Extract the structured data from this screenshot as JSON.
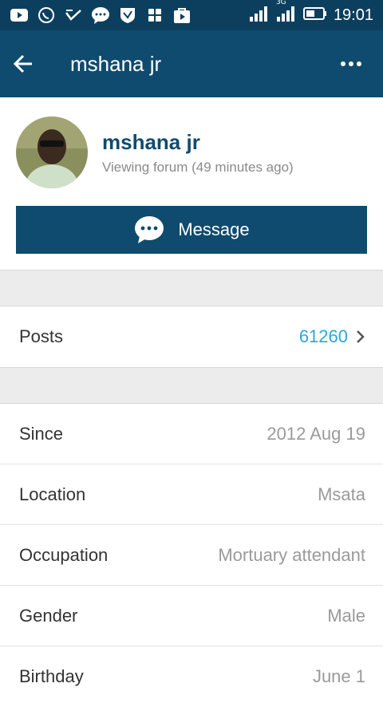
{
  "status_bar": {
    "time": "19:01",
    "network": "3G",
    "icons": [
      "youtube-icon",
      "whatsapp-icon",
      "check-icon",
      "chat-icon",
      "vpn-icon",
      "apps-icon",
      "play-store-icon"
    ]
  },
  "app_bar": {
    "title": "mshana jr",
    "back_icon": "arrow-back-icon",
    "more_icon": "more-horizontal-icon"
  },
  "profile": {
    "username": "mshana jr",
    "activity": "Viewing forum (49 minutes ago)",
    "message_button": "Message"
  },
  "stats": {
    "posts_label": "Posts",
    "posts_value": "61260"
  },
  "details": [
    {
      "label": "Since",
      "value": "2012 Aug 19"
    },
    {
      "label": "Location",
      "value": "Msata"
    },
    {
      "label": "Occupation",
      "value": "Mortuary attendant"
    },
    {
      "label": "Gender",
      "value": "Male"
    },
    {
      "label": "Birthday",
      "value": "June 1"
    }
  ],
  "colors": {
    "status_bar": "#0c3f5e",
    "app_bar": "#0f4b6e",
    "link": "#29a8d6"
  }
}
